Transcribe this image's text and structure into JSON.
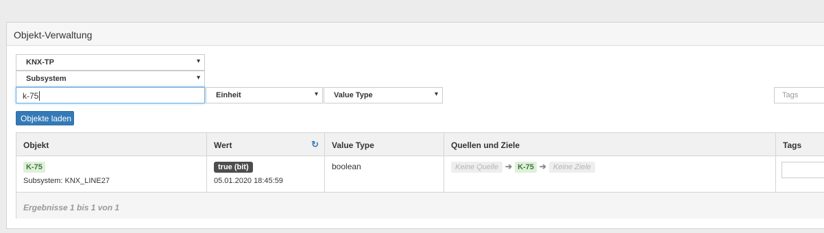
{
  "panel": {
    "title": "Objekt-Verwaltung"
  },
  "filters": {
    "type_select": "KNX-TP",
    "subsystem_select": "Subsystem",
    "search_value": "k-75",
    "unit_select": "Einheit",
    "value_type_select": "Value Type",
    "tags_placeholder": "Tags",
    "caret": "▾"
  },
  "actions": {
    "load_label": "Objekte laden"
  },
  "table": {
    "headers": {
      "objekt": "Objekt",
      "wert": "Wert",
      "value_type": "Value Type",
      "quellen": "Quellen und Ziele",
      "tags": "Tags"
    },
    "row": {
      "object_tag": "K-75",
      "subsystem": "Subsystem: KNX_LINE27",
      "value_badge": "true (bit)",
      "timestamp": "05.01.2020 18:45:59",
      "value_type": "boolean",
      "source": "Keine Quelle",
      "target_tag": "K-75",
      "destination": "Keine Ziele"
    },
    "footer": "Ergebnisse 1 bis 1 von 1"
  },
  "icons": {
    "refresh": "refresh-icon",
    "arrow": "arrow-right-icon"
  },
  "colors": {
    "primary": "#337ab7",
    "tag_green_bg": "#dff0d8",
    "tag_green_fg": "#3c763d",
    "badge_dark": "#4d4d4d"
  }
}
